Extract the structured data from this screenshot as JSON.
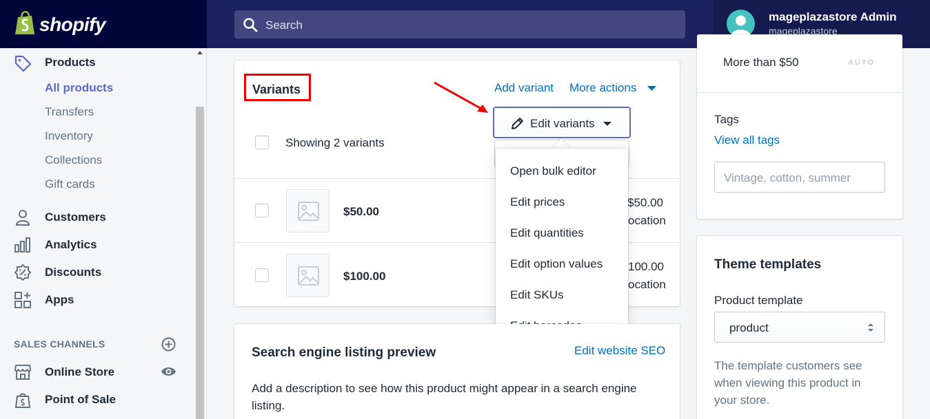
{
  "topbar": {
    "logo_text": "shopify",
    "search_placeholder": "Search",
    "user_name": "mageplazastore Admin",
    "user_store": "mageplazastore"
  },
  "sidebar": {
    "products_label": "Products",
    "sub_items": [
      "All products",
      "Transfers",
      "Inventory",
      "Collections",
      "Gift cards"
    ],
    "main_items": [
      "Customers",
      "Analytics",
      "Discounts",
      "Apps"
    ],
    "section_label": "SALES CHANNELS",
    "channels": [
      "Online Store",
      "Point of Sale"
    ]
  },
  "variants": {
    "title": "Variants",
    "add_variant": "Add variant",
    "more_actions": "More actions",
    "edit_variants": "Edit variants",
    "showing": "Showing 2 variants",
    "rows": [
      {
        "price": "$50.00",
        "right_price": "$50.00",
        "right_sub": "ocation"
      },
      {
        "price": "$100.00",
        "right_price": "100.00",
        "right_sub": "ocation"
      }
    ],
    "dropdown": [
      "Open bulk editor",
      "Edit prices",
      "Edit quantities",
      "Edit option values",
      "Edit SKUs",
      "Edit barcodes"
    ]
  },
  "seo": {
    "title": "Search engine listing preview",
    "edit_link": "Edit website SEO",
    "description": "Add a description to see how this product might appear in a search engine",
    "description_line2": "listing."
  },
  "right_panel": {
    "price_rule": "More than $50",
    "auto_badge": "AUTO",
    "tags_label": "Tags",
    "view_all_tags": "View all tags",
    "tags_placeholder": "Vintage, cotton, summer",
    "theme_title": "Theme templates",
    "product_template_label": "Product template",
    "template_value": "product",
    "help_text": [
      "The template customers see",
      "when viewing this product in",
      "your store."
    ]
  },
  "colors": {
    "topbar": "#1c2260",
    "accent": "#5c6ac4",
    "link": "#006fbb",
    "highlight": "#ee0000"
  }
}
